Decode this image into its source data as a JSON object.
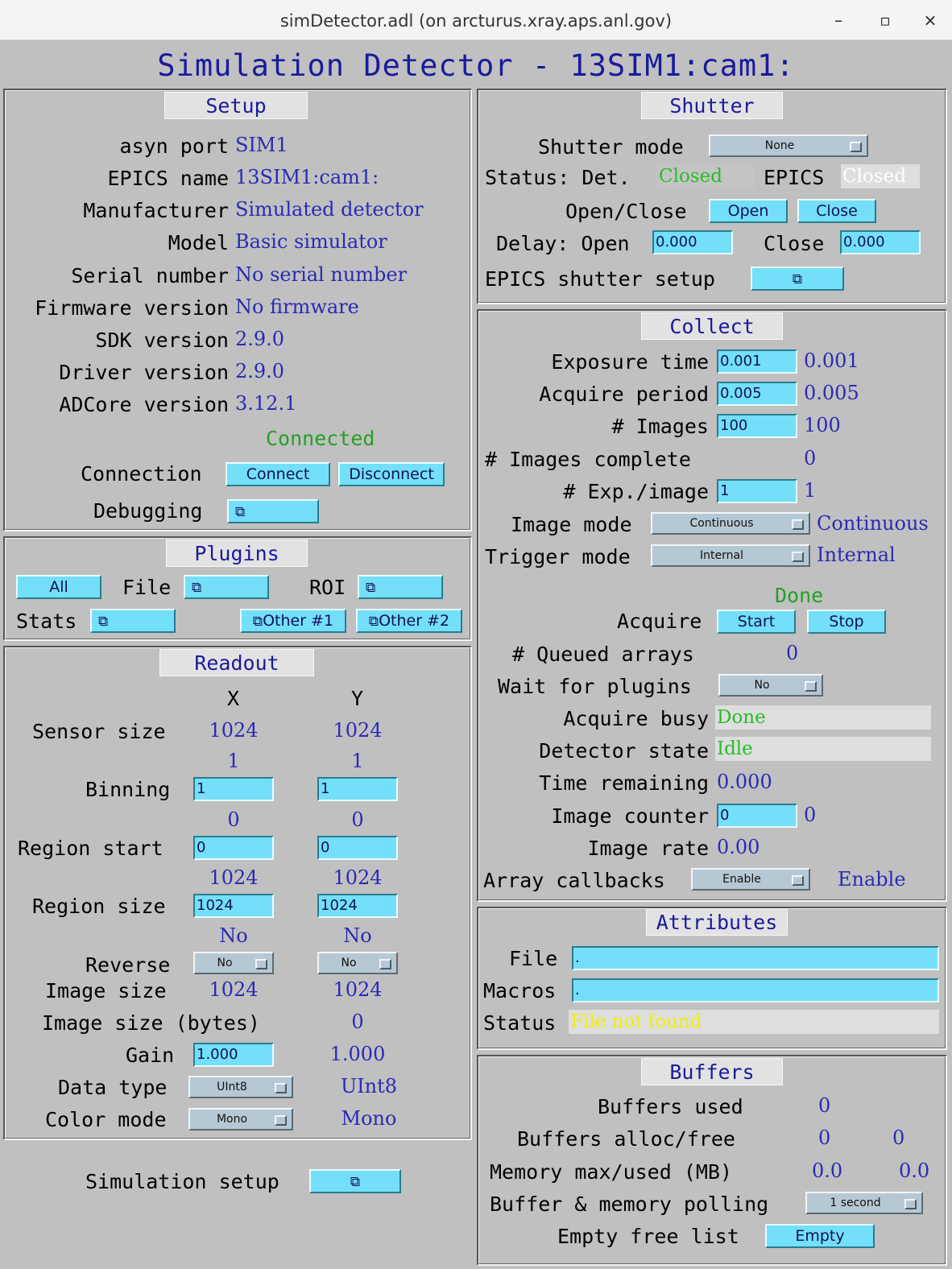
{
  "window": {
    "title": "simDetector.adl (on arcturus.xray.aps.anl.gov)",
    "minimize": "–",
    "maximize": "▫",
    "close": "×"
  },
  "main_title": "Simulation Detector - 13SIM1:cam1:",
  "icons": {
    "related_display": "⧉"
  },
  "setup": {
    "title": "Setup",
    "rows": [
      {
        "label": "asyn port",
        "value": "SIM1"
      },
      {
        "label": "EPICS name",
        "value": "13SIM1:cam1:"
      },
      {
        "label": "Manufacturer",
        "value": "Simulated detector"
      },
      {
        "label": "Model",
        "value": "Basic simulator"
      },
      {
        "label": "Serial number",
        "value": "No serial number"
      },
      {
        "label": "Firmware version",
        "value": "No firmware"
      },
      {
        "label": "SDK version",
        "value": "2.9.0"
      },
      {
        "label": "Driver version",
        "value": "2.9.0"
      },
      {
        "label": "ADCore version",
        "value": "3.12.1"
      }
    ],
    "connection_status": "Connected",
    "connection_label": "Connection",
    "connect": "Connect",
    "disconnect": "Disconnect",
    "debugging_label": "Debugging"
  },
  "plugins": {
    "title": "Plugins",
    "all": "All",
    "file_label": "File",
    "roi_label": "ROI",
    "stats_label": "Stats",
    "other1": "Other #1",
    "other2": "Other #2"
  },
  "readout": {
    "title": "Readout",
    "col_x": "X",
    "col_y": "Y",
    "sensor_size_label": "Sensor size",
    "sensor_size": {
      "x": "1024",
      "y": "1024"
    },
    "binning_rbv": {
      "x": "1",
      "y": "1"
    },
    "binning_label": "Binning",
    "binning": {
      "x": "1",
      "y": "1"
    },
    "region_start_rbv": {
      "x": "0",
      "y": "0"
    },
    "region_start_label": "Region start",
    "region_start": {
      "x": "0",
      "y": "0"
    },
    "region_size_rbv": {
      "x": "1024",
      "y": "1024"
    },
    "region_size_label": "Region size",
    "region_size": {
      "x": "1024",
      "y": "1024"
    },
    "reverse_rbv": {
      "x": "No",
      "y": "No"
    },
    "reverse_label": "Reverse",
    "reverse": {
      "x": "No",
      "y": "No"
    },
    "image_size_label": "Image size",
    "image_size": {
      "x": "1024",
      "y": "1024"
    },
    "image_size_bytes_label": "Image size (bytes)",
    "image_size_bytes": "0",
    "gain_label": "Gain",
    "gain": "1.000",
    "gain_rbv": "1.000",
    "data_type_label": "Data type",
    "data_type": "UInt8",
    "data_type_rbv": "UInt8",
    "color_mode_label": "Color mode",
    "color_mode": "Mono",
    "color_mode_rbv": "Mono"
  },
  "simulation_setup_label": "Simulation setup",
  "shutter": {
    "title": "Shutter",
    "mode_label": "Shutter mode",
    "mode": "None",
    "status_label": "Status: Det.",
    "det_status": "Closed",
    "epics_label": "EPICS",
    "epics_status": "Closed",
    "open_close_label": "Open/Close",
    "open": "Open",
    "close": "Close",
    "delay_open_label": "Delay: Open",
    "delay_open": "0.000",
    "delay_close_label": "Close",
    "delay_close": "0.000",
    "epics_setup_label": "EPICS shutter setup"
  },
  "collect": {
    "title": "Collect",
    "exposure_label": "Exposure time",
    "exposure": "0.001",
    "exposure_rbv": "0.001",
    "period_label": "Acquire period",
    "period": "0.005",
    "period_rbv": "0.005",
    "images_label": "# Images",
    "images": "100",
    "images_rbv": "100",
    "images_complete_label": "# Images complete",
    "images_complete": "0",
    "exp_per_image_label": "# Exp./image",
    "exp_per_image": "1",
    "exp_per_image_rbv": "1",
    "image_mode_label": "Image mode",
    "image_mode": "Continuous",
    "image_mode_rbv": "Continuous",
    "trigger_mode_label": "Trigger mode",
    "trigger_mode": "Internal",
    "trigger_mode_rbv": "Internal",
    "acquire_status": "Done",
    "acquire_label": "Acquire",
    "start": "Start",
    "stop": "Stop",
    "queued_label": "# Queued arrays",
    "queued": "0",
    "wait_label": "Wait for plugins",
    "wait": "No",
    "busy_label": "Acquire busy",
    "busy": "Done",
    "state_label": "Detector state",
    "state": "Idle",
    "time_remaining_label": "Time remaining",
    "time_remaining": "0.000",
    "counter_label": "Image counter",
    "counter": "0",
    "counter_rbv": "0",
    "rate_label": "Image rate",
    "rate": "0.00",
    "callbacks_label": "Array callbacks",
    "callbacks": "Enable",
    "callbacks_rbv": "Enable"
  },
  "attributes": {
    "title": "Attributes",
    "file_label": "File",
    "file": ".",
    "macros_label": "Macros",
    "macros": ".",
    "status_label": "Status",
    "status": "File not found"
  },
  "buffers": {
    "title": "Buffers",
    "used_label": "Buffers used",
    "used": "0",
    "alloc_label": "Buffers alloc/free",
    "alloc": "0",
    "free": "0",
    "memory_label": "Memory max/used (MB)",
    "memory_max": "0.0",
    "memory_used": "0.0",
    "polling_label": "Buffer & memory polling",
    "polling": "1 second",
    "empty_label": "Empty free list",
    "empty": "Empty"
  },
  "colors": {
    "background": "#c0c0c0",
    "title_blue": "#1a1a9c",
    "value_blue": "#2a2ab5",
    "status_green": "#25a025",
    "button_cyan": "#73dff8",
    "warning_yellow": "#f0f000"
  }
}
